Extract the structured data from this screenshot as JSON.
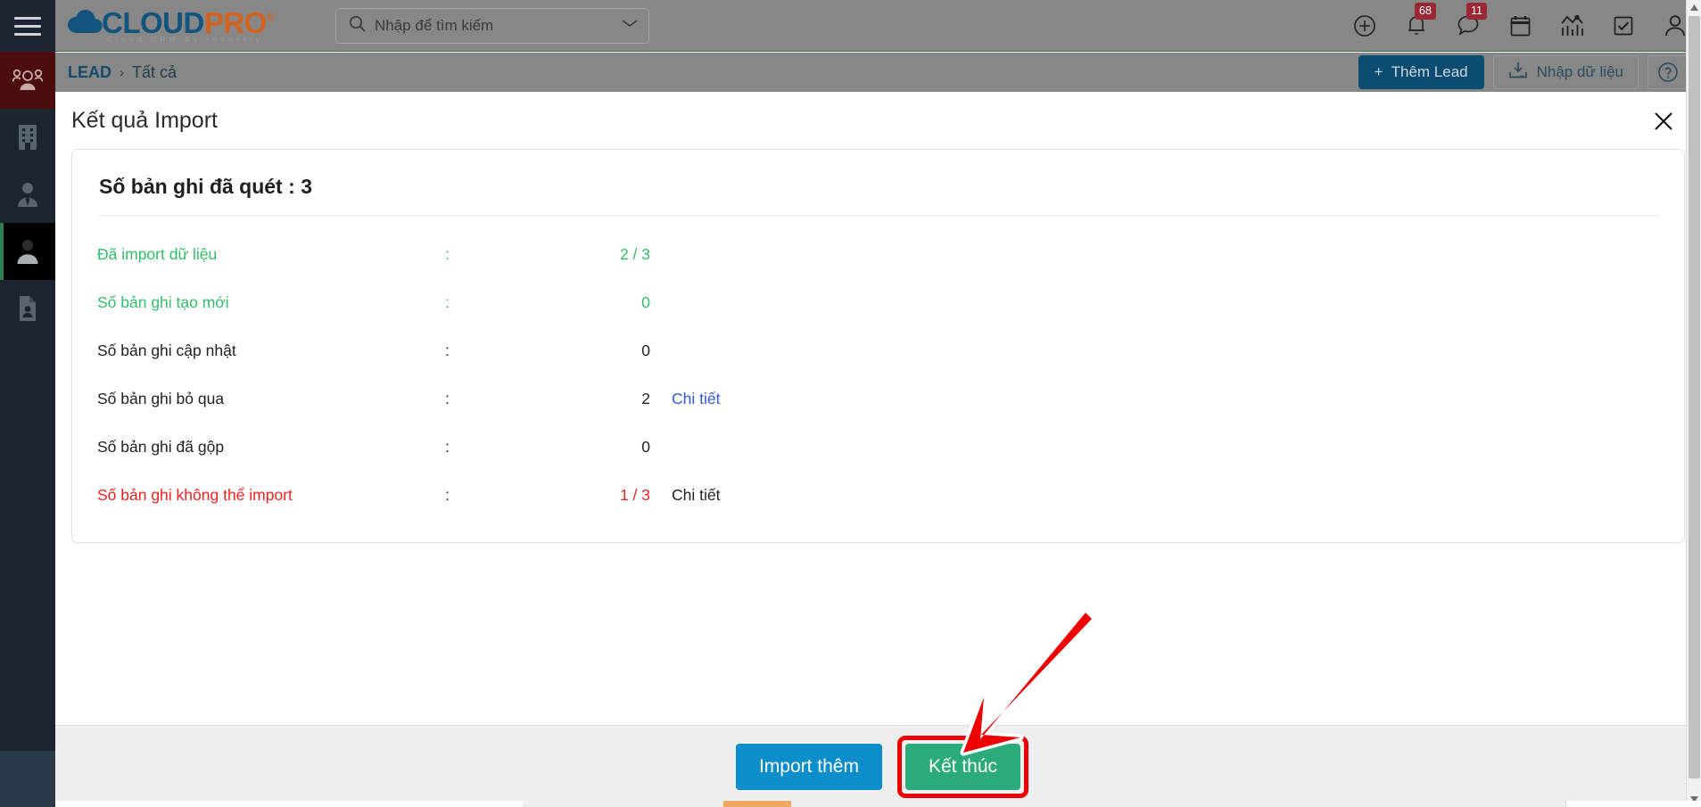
{
  "app": {
    "logo": {
      "cloud": "CLOUD",
      "pro": "PRO",
      "registered": "®",
      "tagline": "Cloud CRM By Industry"
    }
  },
  "header": {
    "search": {
      "placeholder": "Nhập để tìm kiếm",
      "icon": "search-icon"
    },
    "icons": [
      {
        "name": "add-circle-icon",
        "badge": null
      },
      {
        "name": "bell-icon",
        "badge": "68"
      },
      {
        "name": "chat-icon",
        "badge": "11"
      },
      {
        "name": "calendar-icon",
        "badge": null
      },
      {
        "name": "analytics-icon",
        "badge": null
      },
      {
        "name": "task-checkbox-icon",
        "badge": null
      },
      {
        "name": "user-icon",
        "badge": null
      }
    ]
  },
  "breadcrumb": {
    "module": "LEAD",
    "separator": "›",
    "current": "Tất cả",
    "actions": {
      "add_lead": "Thêm Lead",
      "add_lead_prefix": "+",
      "import_data": "Nhập dữ liệu",
      "help": "?"
    }
  },
  "sidebar": {
    "items": [
      {
        "name": "sidebar-item-contacts-group",
        "icon": "people-group-icon",
        "state": "accent"
      },
      {
        "name": "sidebar-item-organizations",
        "icon": "building-icon",
        "state": "normal"
      },
      {
        "name": "sidebar-item-contacts",
        "icon": "person-tie-icon",
        "state": "normal"
      },
      {
        "name": "sidebar-item-leads",
        "icon": "person-icon",
        "state": "active"
      },
      {
        "name": "sidebar-item-documents",
        "icon": "document-person-icon",
        "state": "normal"
      }
    ]
  },
  "modal": {
    "title": "Kết quả Import",
    "close_label": "✕",
    "card": {
      "heading_label": "Số bản ghi đã quét",
      "heading_colon": ":",
      "heading_value": "3"
    },
    "rows": [
      {
        "label": "Đã import dữ liệu",
        "colon": ":",
        "value": "2 / 3",
        "detail": "",
        "label_color": "green",
        "value_color": "green",
        "detail_color": ""
      },
      {
        "label": "Số bản ghi tạo mới",
        "colon": ":",
        "value": "0",
        "detail": "",
        "label_color": "green",
        "value_color": "green",
        "detail_color": ""
      },
      {
        "label": "Số bản ghi cập nhật",
        "colon": ":",
        "value": "0",
        "detail": "",
        "label_color": "dark",
        "value_color": "dark",
        "detail_color": ""
      },
      {
        "label": "Số bản ghi bỏ qua",
        "colon": ":",
        "value": "2",
        "detail": "Chi tiết",
        "label_color": "dark",
        "value_color": "dark",
        "detail_color": "linkblue"
      },
      {
        "label": "Số bản ghi đã gộp",
        "colon": ":",
        "value": "0",
        "detail": "",
        "label_color": "dark",
        "value_color": "dark",
        "detail_color": ""
      },
      {
        "label": "Số bản ghi không thể import",
        "colon": ":",
        "value": "1 / 3",
        "detail": "Chi tiết",
        "label_color": "red",
        "value_color": "red",
        "detail_color": "linkdark"
      }
    ],
    "footer": {
      "import_more": "Import thêm",
      "finish": "Kết thúc"
    }
  },
  "annotation": {
    "arrow_color": "#ef0000",
    "highlight_target": "Kết thúc"
  },
  "colors": {
    "brand_blue": "#13547f",
    "brand_orange": "#d2621f",
    "accent_green": "#31c06a",
    "error_red": "#f4211f",
    "link_blue": "#2e5bd8",
    "button_blue": "#0c8ecb",
    "button_green": "#2bab79",
    "badge_red": "#9c2734"
  }
}
